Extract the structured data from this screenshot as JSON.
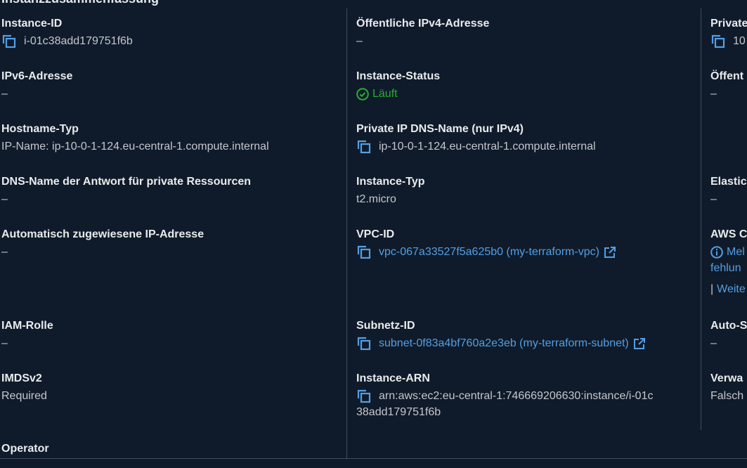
{
  "colors": {
    "background": "#0f1b2a",
    "link": "#539fe5",
    "success": "#29ad32",
    "divider": "#414d5c"
  },
  "heading_partial": "Instanzzusammenfassung",
  "col1": {
    "instance_id": {
      "label": "Instance-ID",
      "value": "i-01c38add179751f6b",
      "icon": "copy-icon"
    },
    "ipv6": {
      "label": "IPv6-Adresse",
      "value": "–"
    },
    "hostname_type": {
      "label": "Hostname-Typ",
      "value": "IP-Name: ip-10-0-1-124.eu-central-1.compute.internal"
    },
    "dns_private": {
      "label": "DNS-Name der Antwort für private Ressourcen",
      "value": "–"
    },
    "auto_ip": {
      "label": "Automatisch zugewiesene IP-Adresse",
      "value": "–"
    },
    "iam_role": {
      "label": "IAM-Rolle",
      "value": "–"
    },
    "imdsv2": {
      "label": "IMDSv2",
      "value": "Required"
    },
    "operator": {
      "label": "Operator"
    }
  },
  "col2": {
    "public_ipv4": {
      "label": "Öffentliche IPv4-Adresse",
      "value": "–"
    },
    "instance_status": {
      "label": "Instance-Status",
      "value": "Läuft",
      "icon": "check-circle-icon"
    },
    "private_dns": {
      "label": "Private IP DNS-Name (nur IPv4)",
      "value": "ip-10-0-1-124.eu-central-1.compute.internal"
    },
    "instance_type": {
      "label": "Instance-Typ",
      "value": "t2.micro"
    },
    "vpc_id": {
      "label": "VPC-ID",
      "value": "vpc-067a33527f5a625b0 (my-terraform-vpc)"
    },
    "subnet_id": {
      "label": "Subnetz-ID",
      "value": "subnet-0f83a4bf760a2e3eb (my-terraform-subnet)"
    },
    "instance_arn": {
      "label": "Instance-ARN",
      "value_line1": "arn:aws:ec2:eu-central-1:746669206630:instance/i-01c",
      "value_line2": "38add179751f6b"
    }
  },
  "col3": {
    "private_ipv4": {
      "label": "Private",
      "value": "10"
    },
    "public_dns": {
      "label": "Öffent",
      "value": "–"
    },
    "elastic_ip": {
      "label": "Elastic",
      "value": "–"
    },
    "aws_compute": {
      "label": "AWS C",
      "line1": "Mel",
      "line2": "fehlun",
      "line3": "Weite"
    },
    "auto_scaling": {
      "label": "Auto-S",
      "value": "–"
    },
    "managed": {
      "label": "Verwa",
      "value": "Falsch"
    }
  }
}
